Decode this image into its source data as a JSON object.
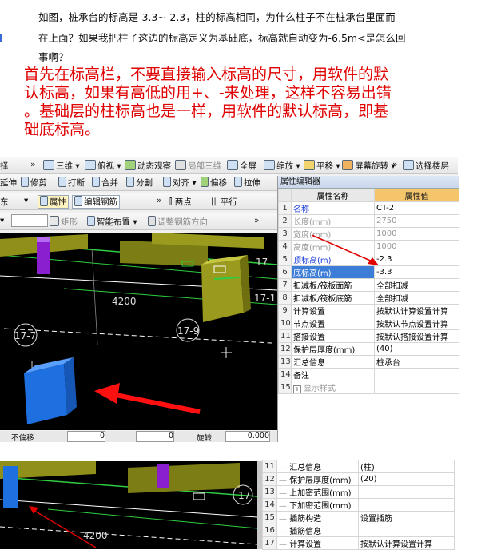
{
  "question": {
    "line1": "如图，桩承台的标高是-3.3~-2.3，柱的标高相同，为什么柱子不在桩承台里面而",
    "line2": "在上面？如果我把柱子这边的标高定义为基础底，标高就自动变为-6.5m<是怎么回",
    "line3": "事啊？"
  },
  "answer": {
    "line1": "首先在标高栏，不要直接输入标高的尺寸，用软件的默",
    "line2": "认标高，如果有高低的用+、-来处理，这样不容易出错",
    "line3": "。基础层的柱标高也是一样，用软件的默认标高，即基",
    "line4": "础底标高。"
  },
  "toolbar1": {
    "view3d": "三维",
    "top_view": "俯视",
    "dynamic_view": "动态观察",
    "local_3d": "局部三维",
    "fullscreen": "全屏",
    "zoom": "缩放",
    "pan": "平移",
    "screen_rotate": "屏幕旋转",
    "select_floor": "选择楼层"
  },
  "toolbar2": {
    "extend": "延伸",
    "trim": "修剪",
    "break": "打断",
    "merge": "合并",
    "split": "分割",
    "align": "对齐",
    "offset": "偏移",
    "stretch": "拉伸"
  },
  "toolbar3": {
    "property": "属性",
    "edit_rebar": "编辑钢筋",
    "two_points": "两点",
    "parallel": "平行"
  },
  "toolbar4": {
    "rect": "矩形",
    "smart_layout": "智能布置",
    "adjust_rebar": "调整钢筋方向"
  },
  "viewport": {
    "dim": "4200",
    "axis_17_1": "17-1",
    "axis_17_7": "17-7",
    "axis_17_9": "17-9",
    "axis_17": "17",
    "statusbar_left": "不偏移",
    "statusbar_x": "0",
    "statusbar_y": "0",
    "statusbar_rotate": "旋转",
    "statusbar_rot_val": "0.000"
  },
  "property_editor": {
    "title": "属性编辑器",
    "col_name": "属性名称",
    "col_value": "属性值",
    "rows": [
      {
        "n": "1",
        "name": "名称",
        "value": "CT-2"
      },
      {
        "n": "2",
        "name": "长度(mm)",
        "value": "2750"
      },
      {
        "n": "3",
        "name": "宽度(mm)",
        "value": "1000"
      },
      {
        "n": "4",
        "name": "高度(mm)",
        "value": "1000"
      },
      {
        "n": "5",
        "name": "顶标高(m)",
        "value": "-2.3"
      },
      {
        "n": "6",
        "name": "底标高(m)",
        "value": "-3.3"
      },
      {
        "n": "7",
        "name": "扣减板/筏板面筋",
        "value": "全部扣减"
      },
      {
        "n": "8",
        "name": "扣减板/筏板底筋",
        "value": "全部扣减"
      },
      {
        "n": "9",
        "name": "计算设置",
        "value": "按默认计算设置计算"
      },
      {
        "n": "10",
        "name": "节点设置",
        "value": "按默认节点设置计算"
      },
      {
        "n": "11",
        "name": "搭接设置",
        "value": "按默认搭接设置计算"
      },
      {
        "n": "12",
        "name": "保护层厚度(mm)",
        "value": "(40)"
      },
      {
        "n": "13",
        "name": "汇总信息",
        "value": "桩承台"
      },
      {
        "n": "14",
        "name": "备注",
        "value": ""
      },
      {
        "n": "15",
        "name": "显示样式",
        "value": ""
      }
    ]
  },
  "viewport2": {
    "dim": "4200",
    "axis_17": "17"
  },
  "property_editor2": {
    "rows": [
      {
        "n": "11",
        "name": "汇总信息",
        "value": "(柱)"
      },
      {
        "n": "12",
        "name": "保护层厚度(mm)",
        "value": "(20)"
      },
      {
        "n": "13",
        "name": "上加密范围(mm)",
        "value": ""
      },
      {
        "n": "14",
        "name": "下加密范围(mm)",
        "value": ""
      },
      {
        "n": "15",
        "name": "插筋构造",
        "value": "设置插筋"
      },
      {
        "n": "16",
        "name": "插筋信息",
        "value": ""
      },
      {
        "n": "17",
        "name": "计算设置",
        "value": "按默认计算设置计算"
      }
    ]
  }
}
